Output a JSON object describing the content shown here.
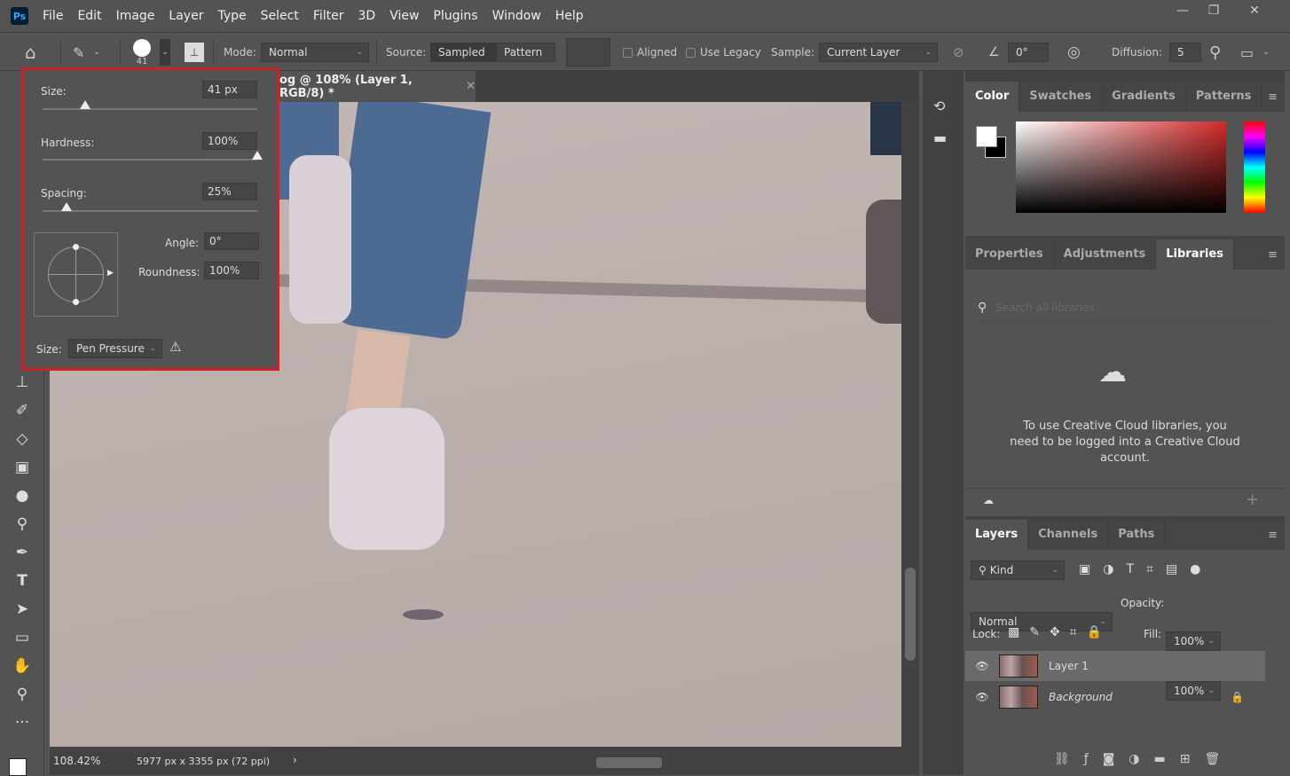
{
  "app": {
    "logo": "Ps",
    "menu": [
      "File",
      "Edit",
      "Image",
      "Layer",
      "Type",
      "Select",
      "Filter",
      "3D",
      "View",
      "Plugins",
      "Window",
      "Help"
    ]
  },
  "options": {
    "brush_size": "41",
    "mode_label": "Mode:",
    "mode_value": "Normal",
    "source_label": "Source:",
    "source_options": [
      "Sampled",
      "Pattern"
    ],
    "aligned": "Aligned",
    "use_legacy": "Use Legacy",
    "sample_label": "Sample:",
    "sample_value": "Current Layer",
    "angle": "0°",
    "diffusion_label": "Diffusion:",
    "diffusion_value": "5"
  },
  "document": {
    "tab_title": "og @ 108% (Layer 1, RGB/8) *",
    "zoom": "108.42%",
    "dimensions": "5977 px x 3355 px (72 ppi)"
  },
  "brush_popup": {
    "size_label": "Size:",
    "size_value": "41 px",
    "size_fraction": 0.2,
    "hardness_label": "Hardness:",
    "hardness_value": "100%",
    "hardness_fraction": 1.0,
    "spacing_label": "Spacing:",
    "spacing_value": "25%",
    "spacing_fraction": 0.11,
    "angle_label": "Angle:",
    "angle_value": "0°",
    "roundness_label": "Roundness:",
    "roundness_value": "100%",
    "pressure_label": "Size:",
    "pressure_value": "Pen Pressure"
  },
  "color_panel": {
    "tabs": [
      "Color",
      "Swatches",
      "Gradients",
      "Patterns"
    ],
    "active": "Color",
    "hue_color": "#d42a2a"
  },
  "libraries_panel": {
    "tabs": [
      "Properties",
      "Adjustments",
      "Libraries"
    ],
    "active": "Libraries",
    "search_placeholder": "Search all libraries",
    "message": "To use Creative Cloud libraries, you need to be logged into a Creative Cloud account."
  },
  "layers_panel": {
    "tabs": [
      "Layers",
      "Channels",
      "Paths"
    ],
    "active": "Layers",
    "filter": "Kind",
    "blend_mode": "Normal",
    "opacity_label": "Opacity:",
    "opacity": "100%",
    "lock_label": "Lock:",
    "fill_label": "Fill:",
    "fill": "100%",
    "layers": [
      {
        "name": "Layer 1",
        "visible": true,
        "selected": true
      },
      {
        "name": "Background",
        "visible": true,
        "locked": true
      }
    ]
  },
  "accent": "#d11f26"
}
